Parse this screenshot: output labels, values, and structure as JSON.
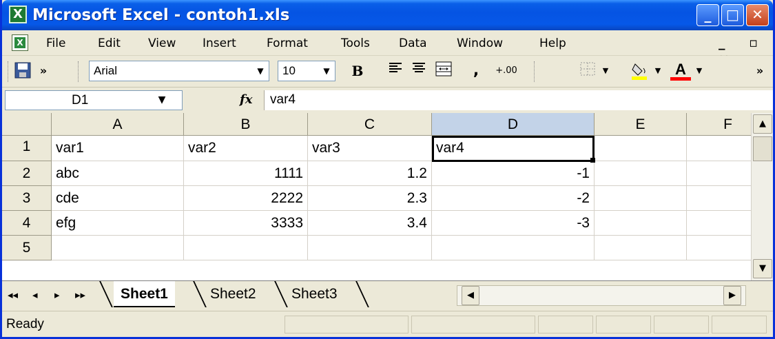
{
  "window": {
    "title": "Microsoft Excel - contoh1.xls",
    "app_icon": "excel-icon",
    "controls": {
      "minimize": "_",
      "maximize": "□",
      "close": "✕"
    }
  },
  "menu": {
    "items": [
      "File",
      "Edit",
      "View",
      "Insert",
      "Format",
      "Tools",
      "Data",
      "Window",
      "Help"
    ],
    "window_controls": "_ ▫ ×"
  },
  "toolbar": {
    "font_name": "Arial",
    "font_size": "10",
    "bold_label": "B",
    "comma_label": ",",
    "decimal_label": "+.00",
    "chevron": "»",
    "font_color_label": "A",
    "fill_color": "#ffff00",
    "font_color": "#ff0000"
  },
  "formula_bar": {
    "name_box": "D1",
    "fx_label": "fx",
    "formula": "var4"
  },
  "grid": {
    "columns": [
      "A",
      "B",
      "C",
      "D",
      "E",
      "F"
    ],
    "selected_column": "D",
    "rows": [
      {
        "header": "1",
        "cells": [
          "var1",
          "var2",
          "var3",
          "var4",
          "",
          ""
        ]
      },
      {
        "header": "2",
        "cells": [
          "abc",
          "1111",
          "1.2",
          "-1",
          "",
          ""
        ]
      },
      {
        "header": "3",
        "cells": [
          "cde",
          "2222",
          "2.3",
          "-2",
          "",
          ""
        ]
      },
      {
        "header": "4",
        "cells": [
          "efg",
          "3333",
          "3.4",
          "-3",
          "",
          ""
        ]
      },
      {
        "header": "5",
        "cells": [
          "",
          "",
          "",
          "",
          "",
          ""
        ]
      }
    ],
    "active_cell": "D1"
  },
  "tabs": {
    "sheets": [
      "Sheet1",
      "Sheet2",
      "Sheet3"
    ],
    "active": "Sheet1",
    "nav": [
      "◂◂",
      "◂",
      "▸",
      "▸▸"
    ]
  },
  "status": {
    "text": "Ready"
  }
}
